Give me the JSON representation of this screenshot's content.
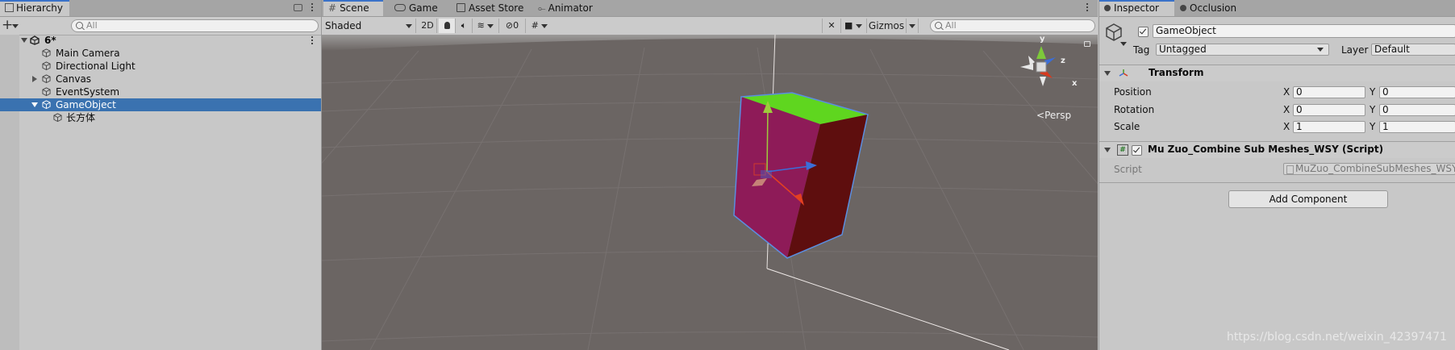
{
  "hierarchy": {
    "tab_label": "Hierarchy",
    "add_label": "+",
    "search_placeholder": "All",
    "scene_name": "6*",
    "items": [
      {
        "label": "Main Camera"
      },
      {
        "label": "Directional Light"
      },
      {
        "label": "Canvas"
      },
      {
        "label": "EventSystem"
      },
      {
        "label": "GameObject"
      },
      {
        "label": "长方体"
      }
    ]
  },
  "scene": {
    "tabs": [
      {
        "label": "Scene"
      },
      {
        "label": "Game"
      },
      {
        "label": "Asset Store"
      },
      {
        "label": "Animator"
      }
    ],
    "draw_mode": "Shaded",
    "mode_2d": "2D",
    "hidden_count": "0",
    "gizmos_label": "Gizmos",
    "search_placeholder": "All",
    "gizmo_axis_y": "y",
    "gizmo_axis_z": "z",
    "gizmo_axis_x": "x",
    "projection_label": "Persp",
    "colors": {
      "top_face": "#5fd61f",
      "front_face": "#8e1b58",
      "side_face": "#5e0e0e",
      "background": "#6b6563"
    }
  },
  "inspector": {
    "tabs": [
      {
        "label": "Inspector"
      },
      {
        "label": "Occlusion"
      }
    ],
    "object_name": "GameObject",
    "tag_label": "Tag",
    "tag_value": "Untagged",
    "layer_label": "Layer",
    "layer_value": "Default",
    "transform": {
      "title": "Transform",
      "rows": [
        {
          "label": "Position",
          "x": "0",
          "y": "0"
        },
        {
          "label": "Rotation",
          "x": "0",
          "y": "0"
        },
        {
          "label": "Scale",
          "x": "1",
          "y": "1"
        }
      ],
      "x_label": "X",
      "y_label": "Y"
    },
    "script_component": {
      "title": "Mu Zuo_Combine Sub Meshes_WSY (Script)",
      "script_label": "Script",
      "script_value": "MuZuo_CombineSubMeshes_WSY"
    },
    "add_component_label": "Add Component"
  },
  "watermark": "https://blog.csdn.net/weixin_42397471"
}
